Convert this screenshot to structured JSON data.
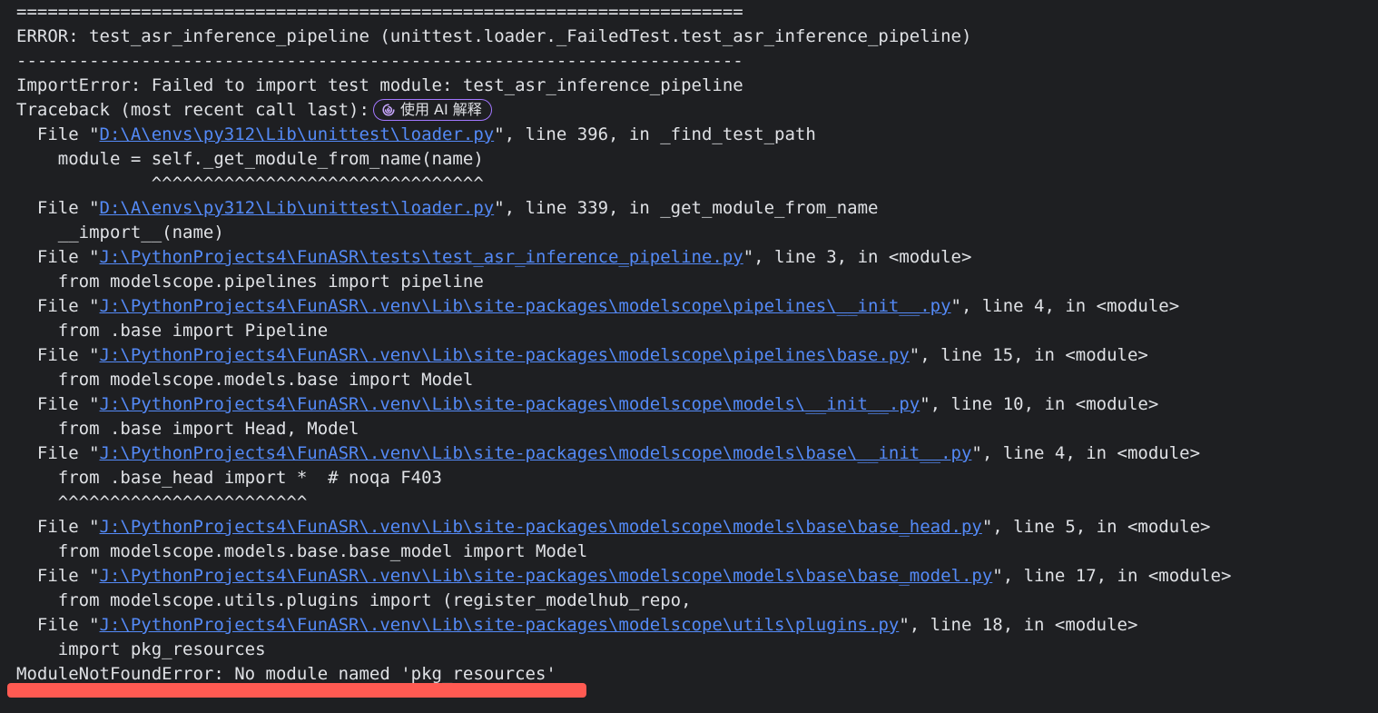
{
  "console": {
    "sep_top": "======================================================================",
    "error_header": "ERROR: test_asr_inference_pipeline (unittest.loader._FailedTest.test_asr_inference_pipeline)",
    "sep_mid": "----------------------------------------------------------------------",
    "import_error": "ImportError: Failed to import test module: test_asr_inference_pipeline",
    "traceback_label": "Traceback (most recent call last):",
    "ai_button_label": "使用 AI 解释",
    "frames": [
      {
        "prefix": "  File \"",
        "path": "D:\\A\\envs\\py312\\Lib\\unittest\\loader.py",
        "suffix": "\", line 396, in _find_test_path"
      },
      {
        "code": "    module = self._get_module_from_name(name)"
      },
      {
        "code": "             ^^^^^^^^^^^^^^^^^^^^^^^^^^^^^^^^"
      },
      {
        "prefix": "  File \"",
        "path": "D:\\A\\envs\\py312\\Lib\\unittest\\loader.py",
        "suffix": "\", line 339, in _get_module_from_name"
      },
      {
        "code": "    __import__(name)"
      },
      {
        "prefix": "  File \"",
        "path": "J:\\PythonProjects4\\FunASR\\tests\\test_asr_inference_pipeline.py",
        "suffix": "\", line 3, in <module>"
      },
      {
        "code": "    from modelscope.pipelines import pipeline"
      },
      {
        "prefix": "  File \"",
        "path": "J:\\PythonProjects4\\FunASR\\.venv\\Lib\\site-packages\\modelscope\\pipelines\\__init__.py",
        "suffix": "\", line 4, in <module>"
      },
      {
        "code": "    from .base import Pipeline"
      },
      {
        "prefix": "  File \"",
        "path": "J:\\PythonProjects4\\FunASR\\.venv\\Lib\\site-packages\\modelscope\\pipelines\\base.py",
        "suffix": "\", line 15, in <module>"
      },
      {
        "code": "    from modelscope.models.base import Model"
      },
      {
        "prefix": "  File \"",
        "path": "J:\\PythonProjects4\\FunASR\\.venv\\Lib\\site-packages\\modelscope\\models\\__init__.py",
        "suffix": "\", line 10, in <module>"
      },
      {
        "code": "    from .base import Head, Model"
      },
      {
        "prefix": "  File \"",
        "path": "J:\\PythonProjects4\\FunASR\\.venv\\Lib\\site-packages\\modelscope\\models\\base\\__init__.py",
        "suffix": "\", line 4, in <module>"
      },
      {
        "code": "    from .base_head import *  # noqa F403"
      },
      {
        "code": "    ^^^^^^^^^^^^^^^^^^^^^^^^"
      },
      {
        "prefix": "  File \"",
        "path": "J:\\PythonProjects4\\FunASR\\.venv\\Lib\\site-packages\\modelscope\\models\\base\\base_head.py",
        "suffix": "\", line 5, in <module>"
      },
      {
        "code": "    from modelscope.models.base.base_model import Model"
      },
      {
        "prefix": "  File \"",
        "path": "J:\\PythonProjects4\\FunASR\\.venv\\Lib\\site-packages\\modelscope\\models\\base\\base_model.py",
        "suffix": "\", line 17, in <module>"
      },
      {
        "code": "    from modelscope.utils.plugins import (register_modelhub_repo,"
      },
      {
        "prefix": "  File \"",
        "path": "J:\\PythonProjects4\\FunASR\\.venv\\Lib\\site-packages\\modelscope\\utils\\plugins.py",
        "suffix": "\", line 18, in <module>"
      },
      {
        "code": "    import pkg_resources"
      }
    ],
    "final_error": "ModuleNotFoundError: No module named 'pkg_resources'",
    "highlight_color": "#ff5a52"
  }
}
